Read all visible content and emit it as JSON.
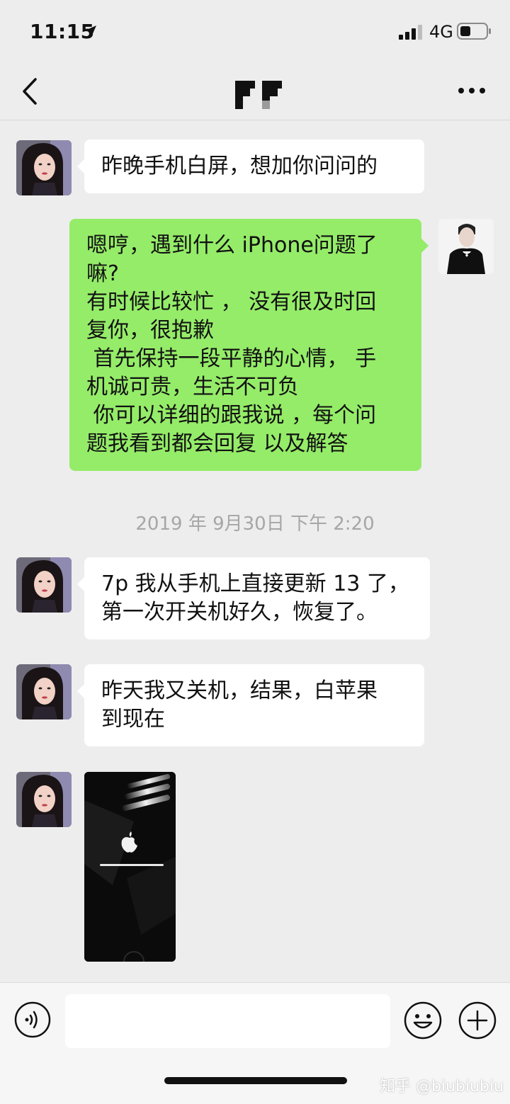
{
  "status_bar": {
    "time": "11:15",
    "network": "4G"
  },
  "nav": {
    "logo_icon": "app-logo-icon"
  },
  "messages": [
    {
      "direction": "in",
      "sender": "contact",
      "text": "昨晚手机白屏，想加你问问的"
    },
    {
      "direction": "out",
      "sender": "me",
      "text": "嗯哼，遇到什么 iPhone问题了\n嘛?\n有时候比较忙 ， 没有很及时回\n复你，很抱歉\n 首先保持一段平静的心情， 手\n机诚可贵，生活不可负\n 你可以详细的跟我说 ，每个问\n题我看到都会回复 以及解答"
    },
    {
      "type": "timestamp",
      "text": "2019 年 9月30日 下午 2:20"
    },
    {
      "direction": "in",
      "sender": "contact",
      "text": "7p 我从手机上直接更新 13 了，\n第一次开关机好久，恢复了。"
    },
    {
      "direction": "in",
      "sender": "contact",
      "text": "昨天我又关机，结果，白苹果\n到现在"
    },
    {
      "direction": "in",
      "sender": "contact",
      "type": "image",
      "image": "white-apple-boot-screen"
    }
  ],
  "input_bar": {
    "placeholder": "",
    "voice_icon": "voice-icon",
    "emoji_icon": "emoji-icon",
    "plus_icon": "plus-icon"
  },
  "watermark": "知乎 @biubiubiu",
  "colors": {
    "background": "#ededed",
    "bubble_out": "#95ec69",
    "bubble_in": "#ffffff",
    "timestamp": "#a6a6a6"
  }
}
